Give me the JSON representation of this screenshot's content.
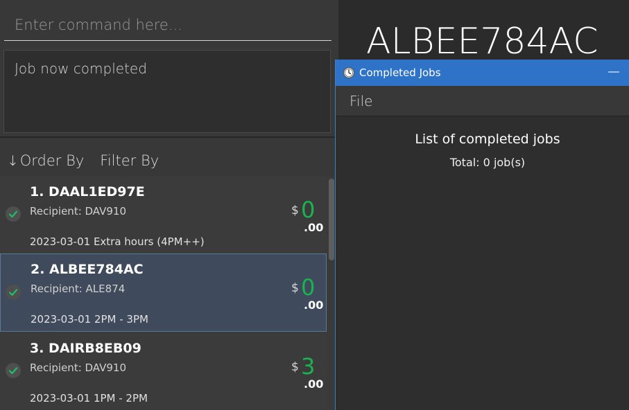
{
  "command": {
    "placeholder": "Enter command here...",
    "value": ""
  },
  "result": {
    "message": "Job now completed"
  },
  "toolbar": {
    "order_label": "Order By",
    "order_icon": "sort-down-arrow-icon",
    "filter_label": "Filter By"
  },
  "jobs": [
    {
      "title": "1.  DAAL1ED97E",
      "recipient": "Recipient: DAV910",
      "date": "2023-03-01 Extra hours (4PM++)",
      "currency": "$",
      "amount": "0",
      "cents": ".00",
      "completed": true,
      "selected": false
    },
    {
      "title": "2.  ALBEE784AC",
      "recipient": "Recipient: ALE874",
      "date": "2023-03-01 2PM  - 3PM",
      "currency": "$",
      "amount": "0",
      "cents": ".00",
      "completed": true,
      "selected": true
    },
    {
      "title": "3.  DAIRB8EB09",
      "recipient": "Recipient: DAV910",
      "date": "2023-03-01 1PM  - 2PM",
      "currency": "$",
      "amount": "3",
      "cents": ".00",
      "completed": true,
      "selected": false
    }
  ],
  "detail": {
    "title": "ALBEE784AC"
  },
  "popup": {
    "title": "Completed Jobs",
    "minimize": "—",
    "menu_file": "File",
    "list_title": "List of completed jobs",
    "total": "Total: 0 job(s)"
  },
  "colors": {
    "amount_green": "#19b34f",
    "popup_titlebar": "#2e73c8",
    "selected_card": "#3f4b5c"
  }
}
